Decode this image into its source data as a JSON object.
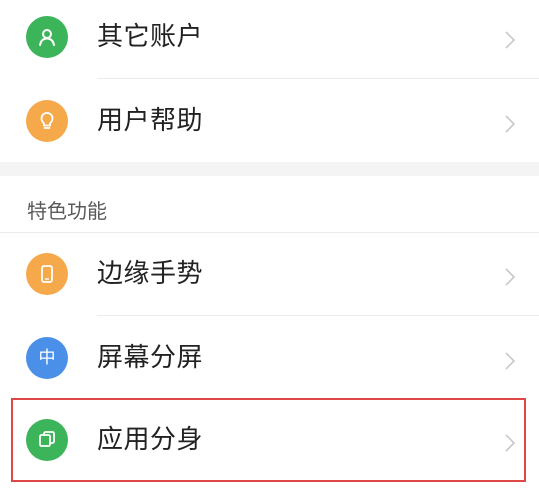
{
  "settings": {
    "items_top": [
      {
        "label": "其它账户",
        "icon": "person-icon",
        "icon_color": "#3cb45a"
      },
      {
        "label": "用户帮助",
        "icon": "lightbulb-icon",
        "icon_color": "#f5a94a"
      }
    ],
    "section": {
      "title": "特色功能",
      "items": [
        {
          "label": "边缘手势",
          "icon": "phone-edge-icon",
          "icon_color": "#f5a94a"
        },
        {
          "label": "屏幕分屏",
          "icon": "split-screen-icon",
          "icon_color": "#4a90e8",
          "icon_text": "中"
        },
        {
          "label": "应用分身",
          "icon": "app-clone-icon",
          "icon_color": "#3cb45a"
        }
      ]
    },
    "highlight_color": "#e04848"
  }
}
